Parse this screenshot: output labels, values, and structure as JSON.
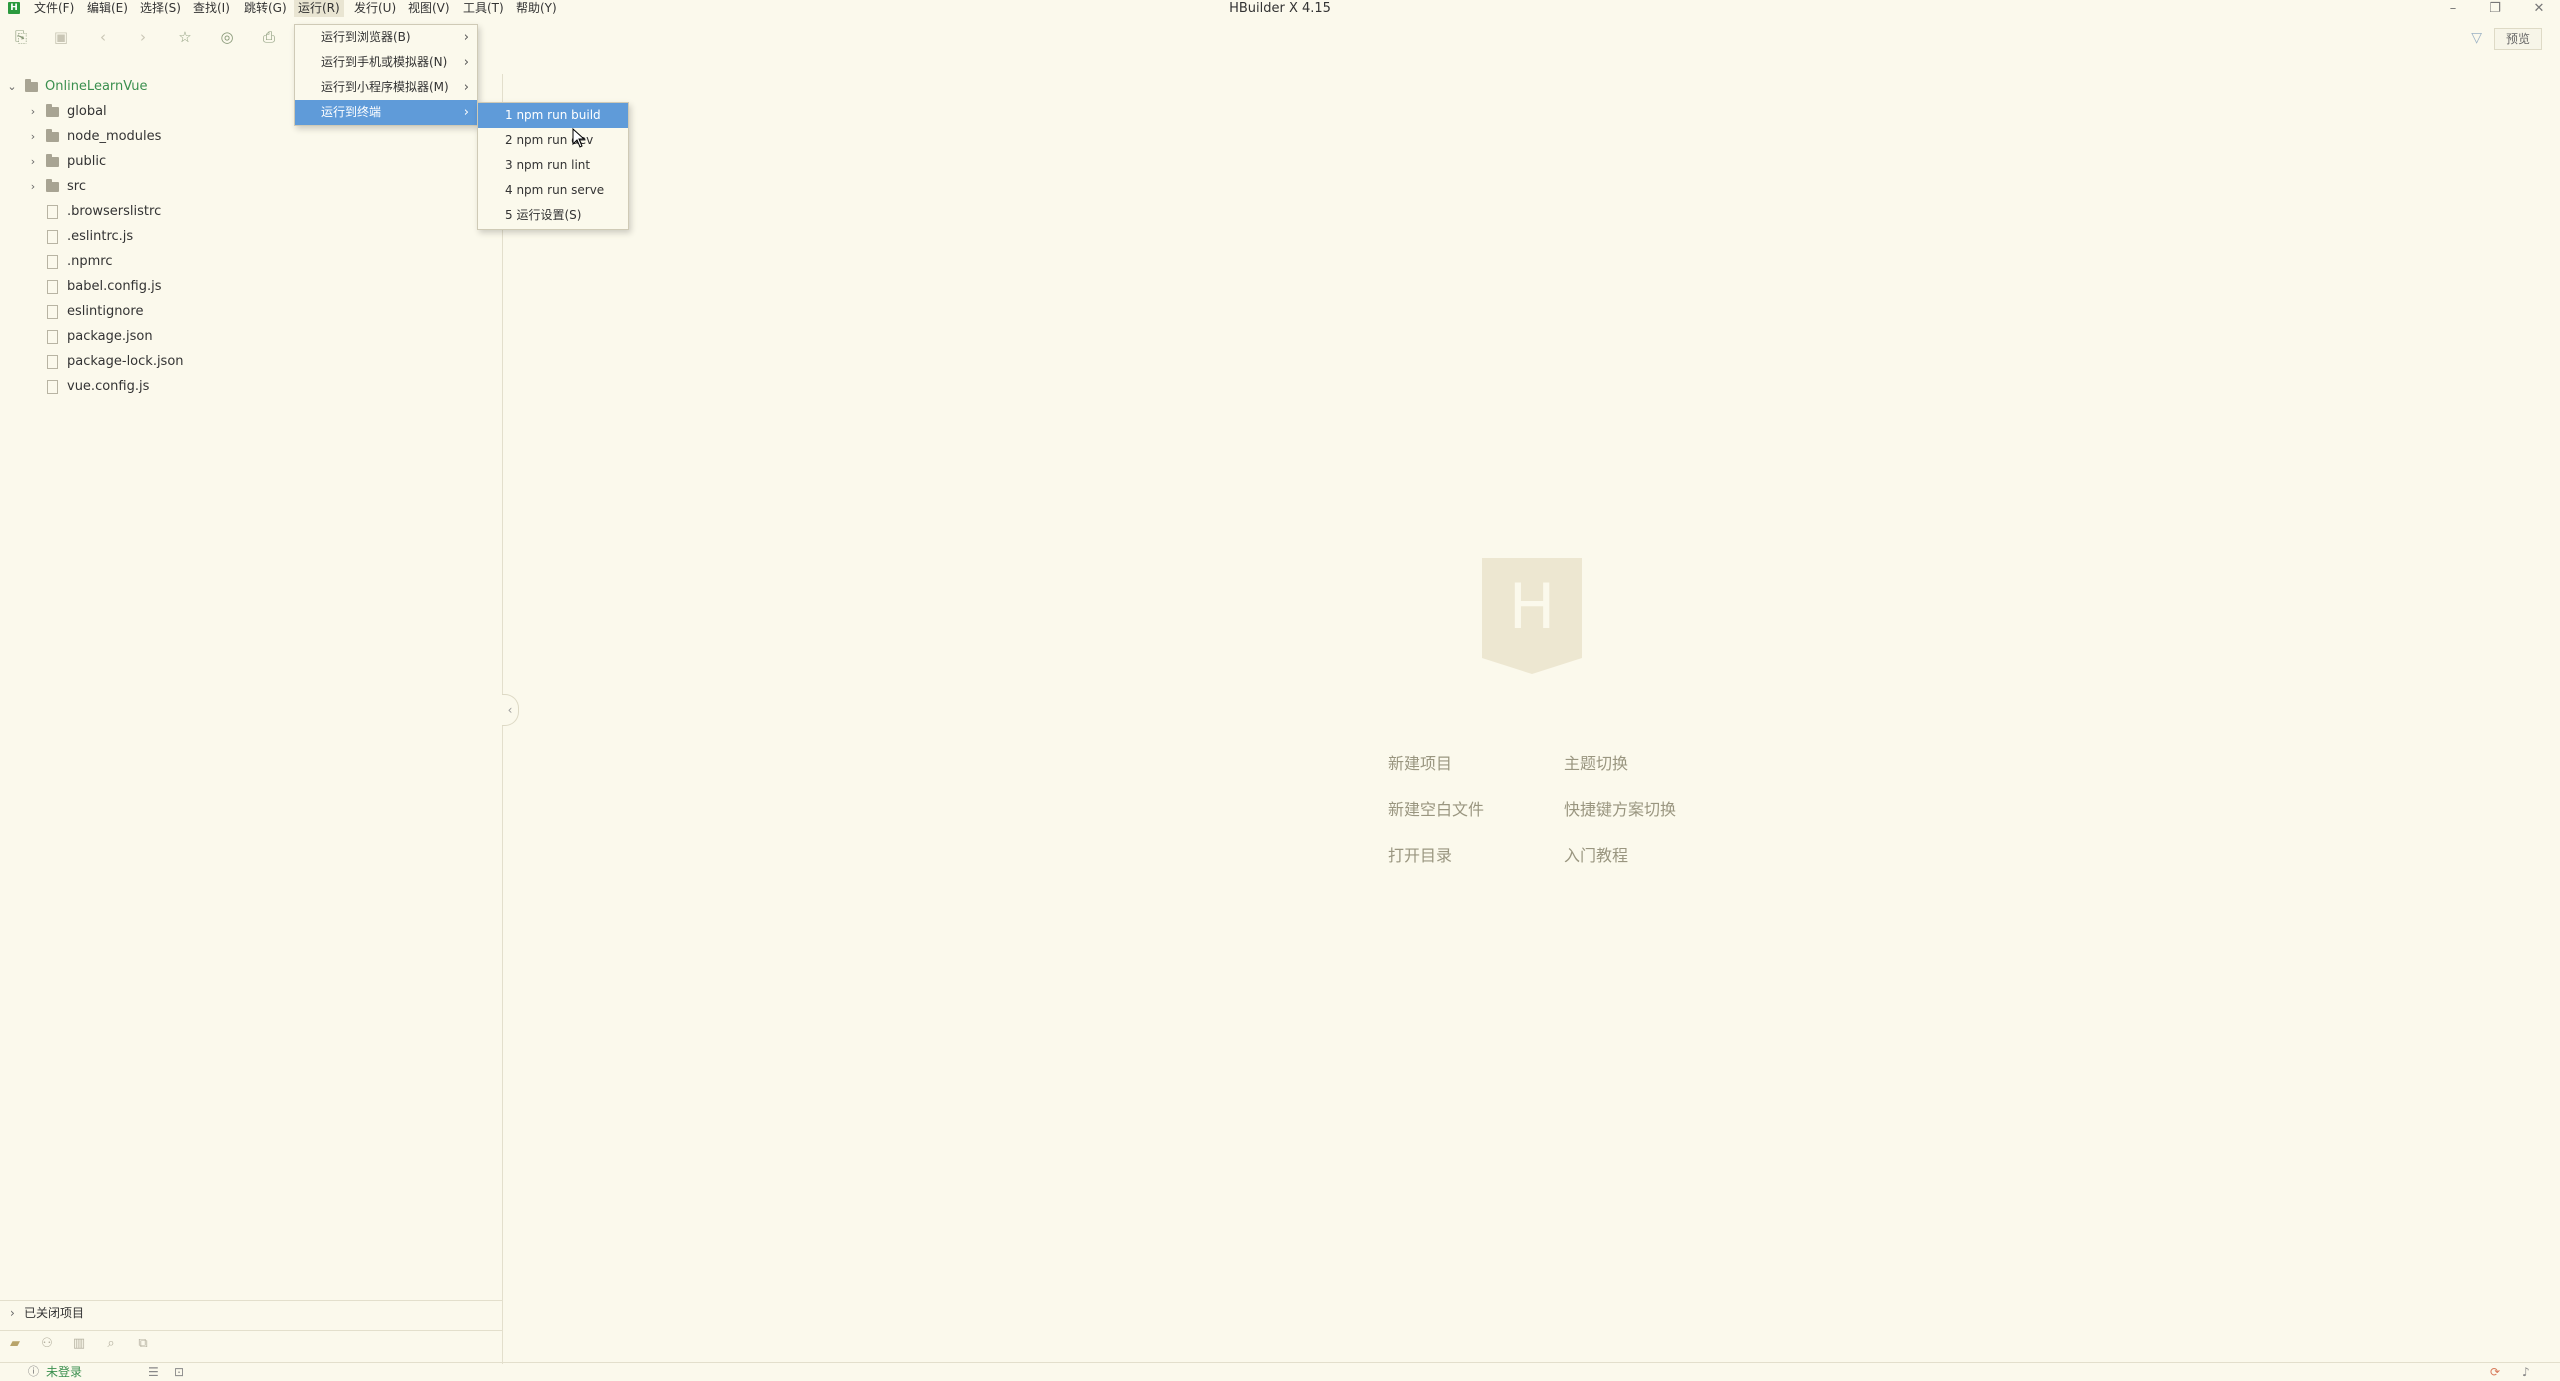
{
  "window": {
    "title": "HBuilder X 4.15",
    "logo_text": "H"
  },
  "menubar": [
    {
      "label": "文件(F)"
    },
    {
      "label": "编辑(E)"
    },
    {
      "label": "选择(S)"
    },
    {
      "label": "查找(I)"
    },
    {
      "label": "跳转(G)"
    },
    {
      "label": "运行(R)"
    },
    {
      "label": "发行(U)"
    },
    {
      "label": "视图(V)"
    },
    {
      "label": "工具(T)"
    },
    {
      "label": "帮助(Y)"
    }
  ],
  "toolbar": {
    "preview_label": "预览"
  },
  "explorer": {
    "root": "OnlineLearnVue",
    "items": [
      {
        "label": "global",
        "kind": "folder"
      },
      {
        "label": "node_modules",
        "kind": "folder"
      },
      {
        "label": "public",
        "kind": "folder"
      },
      {
        "label": "src",
        "kind": "folder"
      },
      {
        "label": ".browserslistrc",
        "kind": "file"
      },
      {
        "label": ".eslintrc.js",
        "kind": "file"
      },
      {
        "label": ".npmrc",
        "kind": "file"
      },
      {
        "label": "babel.config.js",
        "kind": "file"
      },
      {
        "label": "eslintignore",
        "kind": "file"
      },
      {
        "label": "package.json",
        "kind": "file"
      },
      {
        "label": "package-lock.json",
        "kind": "file"
      },
      {
        "label": "vue.config.js",
        "kind": "file"
      }
    ],
    "closed_projects": "已关闭项目"
  },
  "run_menu": {
    "items": [
      {
        "label": "运行到浏览器(B)"
      },
      {
        "label": "运行到手机或模拟器(N)"
      },
      {
        "label": "运行到小程序模拟器(M)"
      },
      {
        "label": "运行到终端"
      }
    ]
  },
  "terminal_submenu": {
    "items": [
      {
        "label": "1 npm run build"
      },
      {
        "label": "2 npm run dev"
      },
      {
        "label": "3 npm run lint"
      },
      {
        "label": "4 npm run serve"
      },
      {
        "label": "5 运行设置(S)"
      }
    ]
  },
  "welcome": {
    "logo_letter": "H",
    "links": {
      "new_project": "新建项目",
      "theme_switch": "主题切换",
      "new_blank_file": "新建空白文件",
      "keymap_switch": "快捷键方案切换",
      "open_directory": "打开目录",
      "tutorial": "入门教程"
    }
  },
  "statusbar": {
    "login": "未登录"
  },
  "colors": {
    "background": "#fbf9ec",
    "accent": "#5f9bd9",
    "brand_green": "#2b9a3e"
  }
}
